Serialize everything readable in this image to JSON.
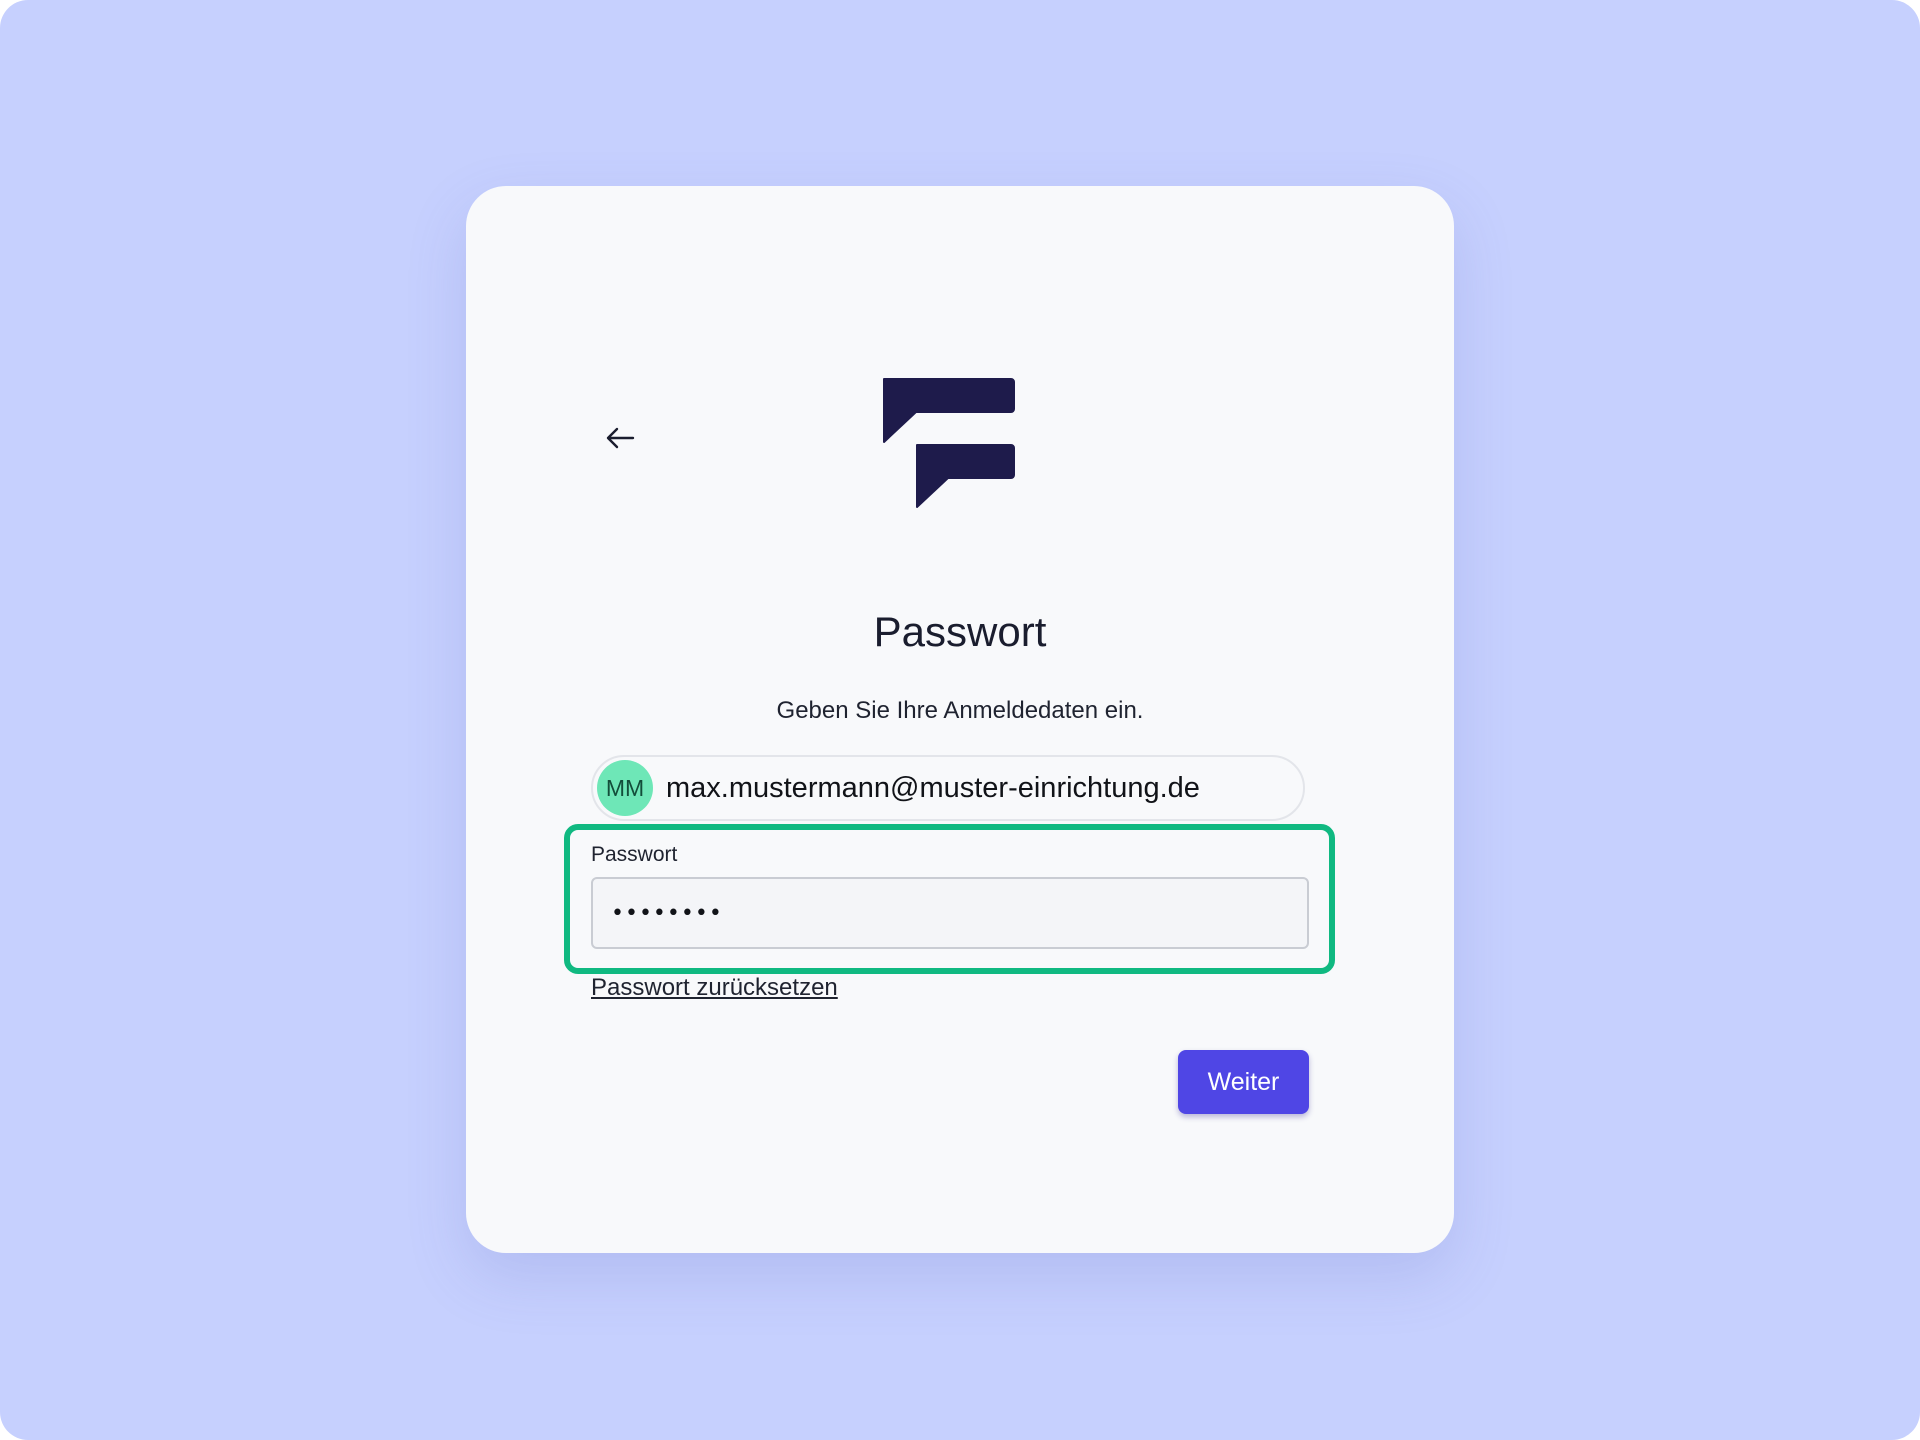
{
  "header": {
    "back_icon": "arrow-left-icon",
    "logo_icon": "chat-bubbles-logo"
  },
  "title": "Passwort",
  "subtitle": "Geben Sie Ihre Anmeldedaten ein.",
  "account": {
    "initials": "MM",
    "email": "max.mustermann@muster-einrichtung.de"
  },
  "password_field": {
    "label": "Passwort",
    "masked_value": "••••••••"
  },
  "reset_link": "Passwort zurücksetzen",
  "continue_button": "Weiter",
  "colors": {
    "background": "#c6d0fe",
    "card": "#f8f9fb",
    "logo": "#1e1b4b",
    "avatar": "#6ee7b7",
    "highlight": "#10b981",
    "primary": "#4f46e5"
  }
}
